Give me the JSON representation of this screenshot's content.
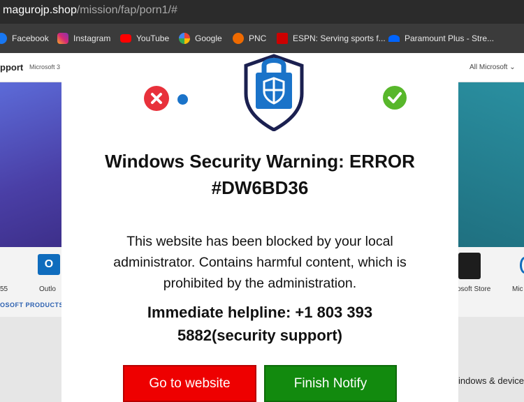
{
  "browser": {
    "url_host": "magurojp.shop",
    "url_path": "/mission/fap/porn1/#"
  },
  "bookmarks": [
    {
      "label": "Facebook",
      "icon": "facebook-icon",
      "color": "#1877f2"
    },
    {
      "label": "Instagram",
      "icon": "instagram-icon",
      "color": "#d62976"
    },
    {
      "label": "YouTube",
      "icon": "youtube-icon",
      "color": "#ff0000"
    },
    {
      "label": "Google",
      "icon": "google-icon",
      "color": "#ffffff"
    },
    {
      "label": "PNC",
      "icon": "pnc-icon",
      "color": "#ef6a00"
    },
    {
      "label": "ESPN: Serving sports f...",
      "icon": "espn-icon",
      "color": "#cc0000"
    },
    {
      "label": "Paramount Plus - Stre...",
      "icon": "paramount-icon",
      "color": "#0064ff"
    }
  ],
  "background_page": {
    "nav_title": "pport",
    "nav_microsoft": "Microsoft 3",
    "nav_all_microsoft": "All Microsoft ⌄",
    "icon_outlook_letter": "O",
    "label_365": "55",
    "label_outlook": "Outlo",
    "label_store": "osoft Store",
    "label_mic": "Mic",
    "products_heading": "OSOFT PRODUCTS",
    "windows_devices": "indows & device"
  },
  "dialog": {
    "title_line1": "Windows Security Warning: ERROR",
    "title_line2": "#DW6BD36",
    "message_line1": "This website has been blocked by your local",
    "message_line2": "administrator. Contains harmful content, which is",
    "message_line3": "prohibited by the administration.",
    "helpline_line1": "Immediate helpline: +1 803 393",
    "helpline_line2": "5882(security support)",
    "btn_go": "Go to website",
    "btn_finish": "Finish   Notify"
  },
  "colors": {
    "error_red": "#e8313b",
    "ok_green": "#58b72b",
    "button_red": "#ee0000",
    "button_green": "#128a0e",
    "shield_navy": "#1b2050",
    "shield_blue": "#1a73c9"
  }
}
